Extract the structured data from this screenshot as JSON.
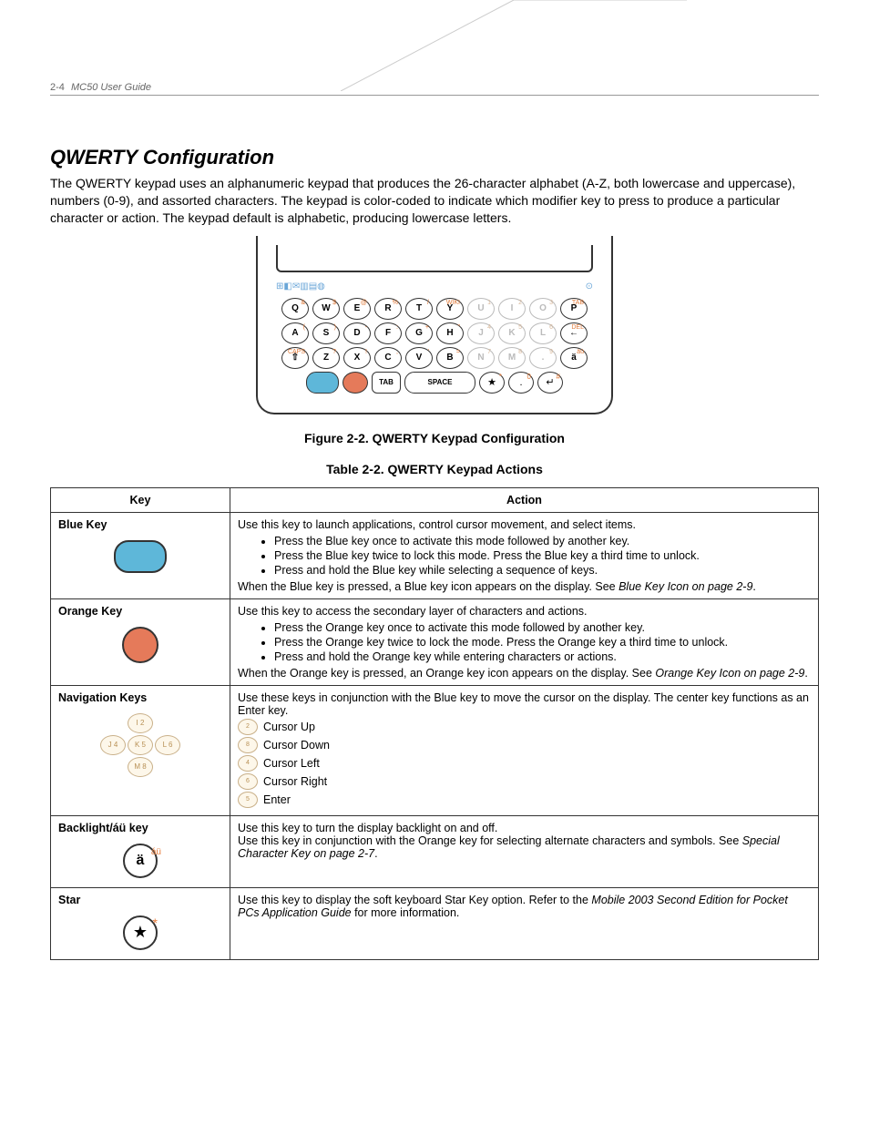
{
  "header": {
    "page": "2-4",
    "title": "MC50 User Guide"
  },
  "section_title": "QWERTY Configuration",
  "intro": "The QWERTY keypad uses an alphanumeric keypad that produces the 26-character alphabet (A-Z, both lowercase and uppercase), numbers (0-9), and assorted characters. The keypad is color-coded to indicate which modifier key to press to produce a particular character or action. The keypad default is alphabetic, producing lowercase letters.",
  "figure_caption": "Figure 2-2.  QWERTY Keypad Configuration",
  "table_caption": "Table 2-2. QWERTY Keypad Actions",
  "table_headers": {
    "key": "Key",
    "action": "Action"
  },
  "keypad": {
    "row1": [
      {
        "k": "Q",
        "s": "&"
      },
      {
        "k": "W",
        "s": "$"
      },
      {
        "k": "E",
        "s": "@"
      },
      {
        "k": "R",
        "s": "%"
      },
      {
        "k": "T",
        "s": "/"
      },
      {
        "k": "Y",
        "s": "WIKI"
      },
      {
        "k": "U",
        "s": "1",
        "f": true
      },
      {
        "k": "I",
        "s": "2",
        "f": true
      },
      {
        "k": "O",
        "s": "3",
        "f": true
      },
      {
        "k": "P",
        "s": "TAB"
      }
    ],
    "row2": [
      {
        "k": "A",
        "s": "("
      },
      {
        "k": "S",
        "s": ")"
      },
      {
        "k": "D",
        "s": "-"
      },
      {
        "k": "F",
        "s": ":"
      },
      {
        "k": "G",
        "s": "+"
      },
      {
        "k": "H",
        "s": "\""
      },
      {
        "k": "J",
        "s": "4",
        "f": true
      },
      {
        "k": "K",
        "s": "5",
        "f": true
      },
      {
        "k": "L",
        "s": "6",
        "f": true
      },
      {
        "k": "←",
        "s": "DEL"
      }
    ],
    "row3": [
      {
        "k": "",
        "s": "CAPS",
        "shift": true
      },
      {
        "k": "Z",
        "s": "?"
      },
      {
        "k": "X",
        "s": "!"
      },
      {
        "k": "C",
        "s": ","
      },
      {
        "k": "V",
        "s": "'"
      },
      {
        "k": "B",
        "s": "="
      },
      {
        "k": "N",
        "s": "7",
        "f": true
      },
      {
        "k": "M",
        "s": "8",
        "f": true
      },
      {
        "k": "",
        "s": "9",
        "f": true,
        "dot": true
      },
      {
        "k": "ä",
        "s": "äü"
      }
    ],
    "tab": "TAB",
    "space": "SPACE"
  },
  "rows": [
    {
      "key_label": "Blue Key",
      "intro": "Use this key to launch applications, control cursor movement, and select items.",
      "bullets": [
        "Press the Blue key once to activate this mode followed by another key.",
        "Press the Blue key twice to lock this mode. Press the Blue key a third time to unlock.",
        "Press and hold the Blue key while selecting a sequence of keys."
      ],
      "outro_a": "When the Blue key is pressed, a Blue key icon appears on the display. See ",
      "outro_ital": "Blue Key Icon on page 2-9",
      "outro_b": "."
    },
    {
      "key_label": "Orange Key",
      "intro": "Use this key to access the secondary layer of characters and actions.",
      "bullets": [
        "Press the Orange key once to activate this mode followed by another key.",
        "Press the Orange key twice to lock the mode. Press the Orange key a third time to unlock.",
        "Press and hold the Orange key while entering characters or actions."
      ],
      "outro_a": "When the Orange key is pressed, an Orange key icon appears on the display. See ",
      "outro_ital": "Orange Key Icon on page 2-9",
      "outro_b": "."
    },
    {
      "key_label": "Navigation Keys",
      "intro": "Use these keys in conjunction with the Blue key to move the cursor on the display. The center key functions as an Enter key.",
      "list": [
        "Cursor Up",
        "Cursor Down",
        "Cursor Left",
        "Cursor Right",
        "Enter"
      ]
    },
    {
      "key_label": "Backlight/áü key",
      "line1": "Use this key to turn the display backlight on and off.",
      "line2a": "Use this key in conjunction with the Orange key for selecting alternate characters and symbols. See ",
      "line2ital": "Special Character Key on page 2-7",
      "line2b": "."
    },
    {
      "key_label": "Star",
      "line1a": "Use this key to display the soft keyboard Star Key option. Refer to the ",
      "line1ital": "Mobile 2003 Second Edition for Pocket PCs Application Guide",
      "line1b": " for more information."
    }
  ]
}
